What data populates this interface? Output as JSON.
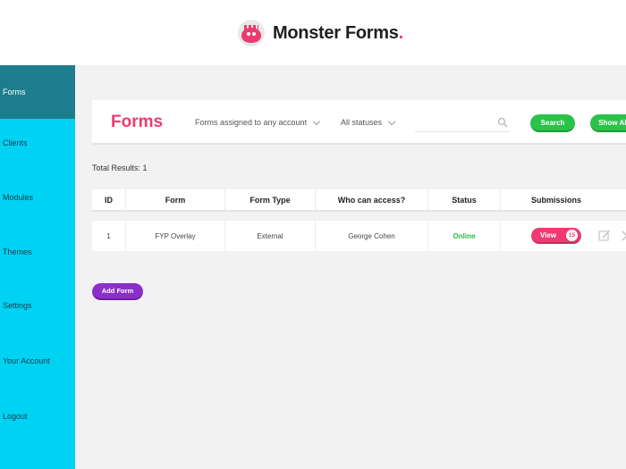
{
  "brand": {
    "name": "Monster Forms",
    "dot": ".",
    "accent": "#ee3a71",
    "icon": "monster-logo-icon"
  },
  "sidebar": {
    "bg": "#00d2f4",
    "active_bg": "#1e7d8c",
    "items": [
      {
        "label": "Forms",
        "active": true
      },
      {
        "label": "Clients"
      },
      {
        "label": "Modules"
      },
      {
        "label": "Themes"
      },
      {
        "label": "Settings"
      },
      {
        "label": "Your Account"
      },
      {
        "label": "Logout"
      }
    ]
  },
  "toolbar": {
    "title": "Forms",
    "account_filter": "Forms assigned to any account",
    "status_filter": "All statuses",
    "search_placeholder": "",
    "search_icon": "search-icon",
    "search_label": "Search",
    "show_all_label": "Show All"
  },
  "total_results": "Total Results: 1",
  "table": {
    "columns": [
      "ID",
      "Form",
      "Form Type",
      "Who can access?",
      "Status",
      "Submissions"
    ],
    "rows": [
      {
        "id": "1",
        "form": "FYP Overlay",
        "type": "External",
        "access": "George Cohen",
        "status": "Online",
        "view_label": "View",
        "submissions": "15"
      }
    ]
  },
  "add_form_label": "Add Form",
  "colors": {
    "online": "#2bbd3f",
    "search_btn": "#2bc24a",
    "add_btn": "#8b2fc9"
  }
}
